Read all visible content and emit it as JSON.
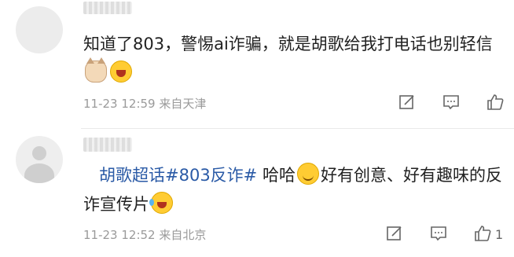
{
  "comments": [
    {
      "text_before": "知道了803，警惕ai诈骗，就是胡歌给我打电话也别轻信",
      "emojis": [
        "cat-face-emoji",
        "laughing-emoji"
      ],
      "timestamp": "11-23 12:59",
      "location": "来自天津",
      "like_count": ""
    },
    {
      "topic": "胡歌超话#803反诈#",
      "text_mid": "哈哈",
      "text_after": "好有创意、好有趣味的反诈宣传片",
      "emojis": [
        "smile-emoji",
        "tears-of-joy-emoji"
      ],
      "timestamp": "11-23 12:52",
      "location": "来自北京",
      "like_count": "1"
    }
  ],
  "icons": [
    "edit-icon",
    "comment-icon",
    "thumbs-up-icon"
  ],
  "colors": {
    "topic": "#2a5aa6",
    "meta": "#9a9a9a",
    "text": "#222222"
  }
}
